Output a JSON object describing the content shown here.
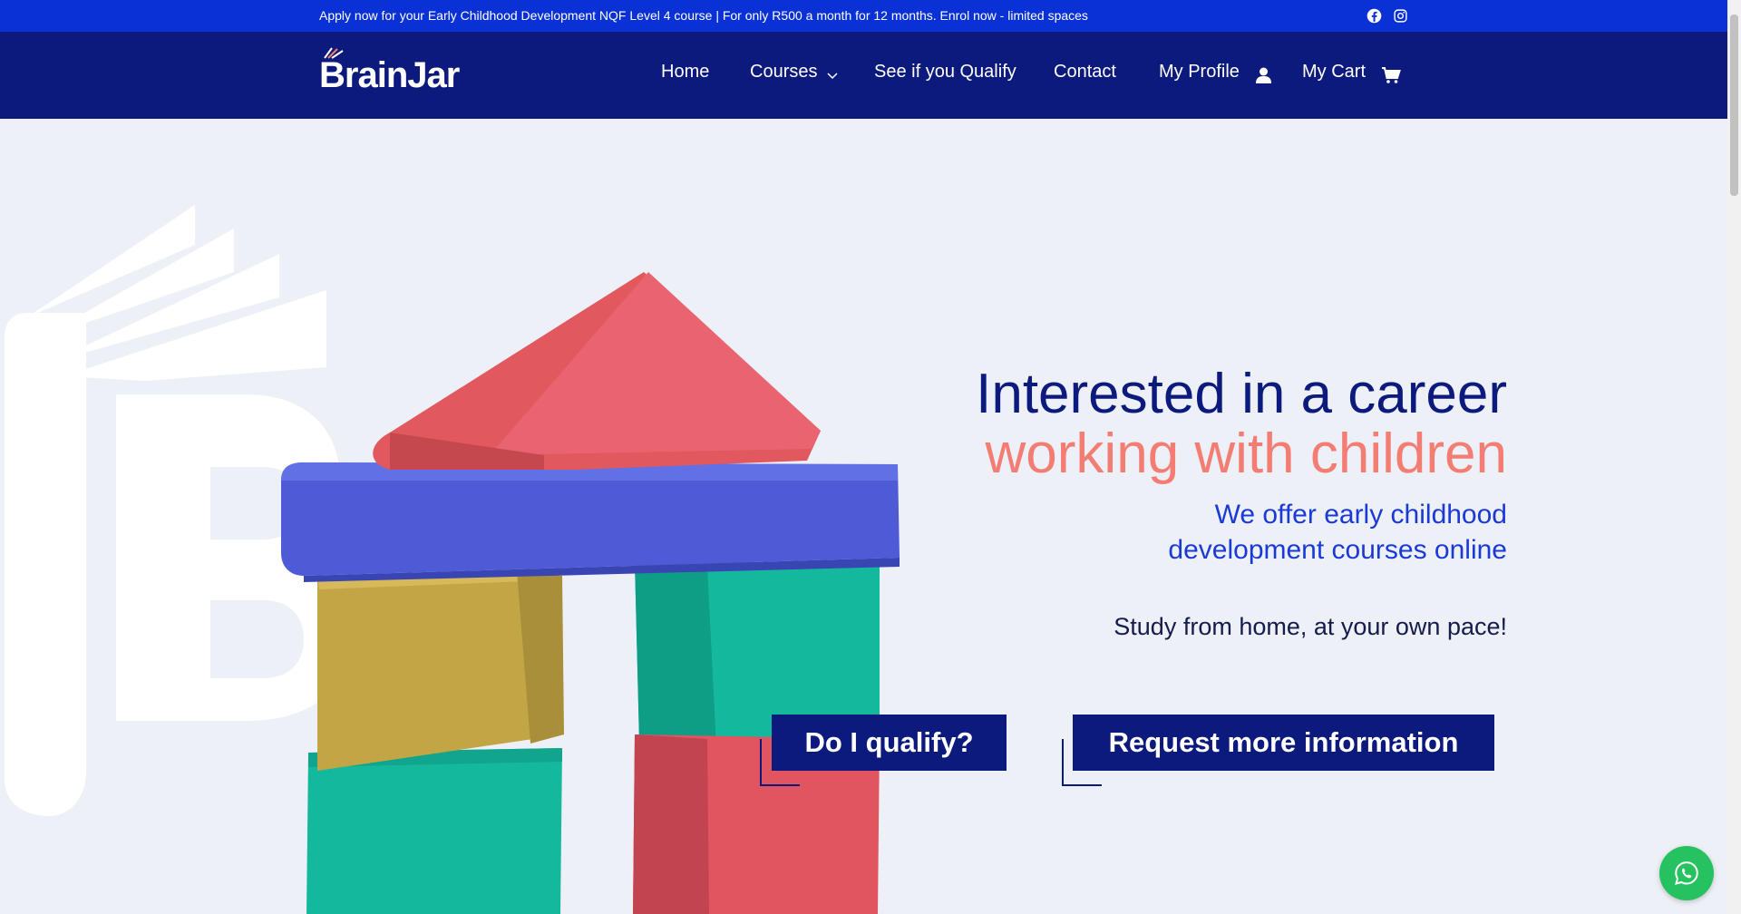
{
  "topbar": {
    "promo": "Apply now for your Early Childhood Development NQF Level 4 course | For only R500 a month for 12 months. Enrol now - limited spaces",
    "social": [
      "facebook-icon",
      "instagram-icon"
    ]
  },
  "logo": {
    "text": "BrainJar"
  },
  "nav": {
    "home": "Home",
    "courses": "Courses",
    "qualify": "See if you Qualify",
    "contact": "Contact",
    "profile": "My Profile",
    "cart": "My Cart"
  },
  "hero": {
    "title_line1": "Interested in a career",
    "title_line2": "working with children",
    "subtitle": "We offer early childhood development courses online",
    "study": "Study from home, at your own pace!",
    "btn_qualify": "Do I qualify?",
    "btn_request": "Request more information"
  },
  "colors": {
    "topbar": "#0a31d6",
    "navbar": "#0c1a7e",
    "accent_coral": "#f37d73",
    "accent_blue": "#1a3ad6",
    "whatsapp": "#25c25f"
  }
}
